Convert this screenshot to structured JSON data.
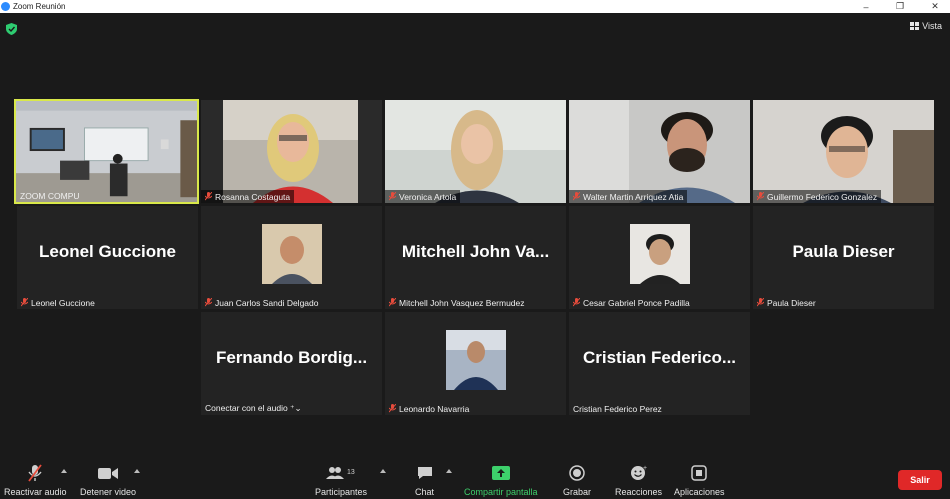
{
  "window": {
    "title": "Zoom Reunión",
    "minimize": "–",
    "maximize": "❐",
    "close": "✕"
  },
  "header": {
    "view_label": "Vista"
  },
  "tiles": [
    {
      "name": "ZOOM COMPU"
    },
    {
      "name": "Rosanna Costaguta"
    },
    {
      "name": "Veronica Artola"
    },
    {
      "name": "Walter Martin Arriquez Atia"
    },
    {
      "name": "Guillermo Federico Gonzalez"
    },
    {
      "big": "Leonel Guccione",
      "name": "Leonel Guccione"
    },
    {
      "name": "Juan Carlos Sandi Delgado"
    },
    {
      "big": "Mitchell John Va...",
      "name": "Mitchell John Vasquez Bermudez"
    },
    {
      "name": "Cesar Gabriel Ponce Padilla"
    },
    {
      "big": "Paula Dieser",
      "name": "Paula Dieser"
    },
    {
      "big": "Fernando Bordig...",
      "name": "Conectar con el audio ⁺⌄"
    },
    {
      "name": "Leonardo Navarria"
    },
    {
      "big": "Cristian Federico...",
      "name": "Cristian Federico Perez"
    }
  ],
  "toolbar": {
    "audio": "Reactivar audio",
    "video": "Detener video",
    "participants": "Participantes",
    "participants_count": "13",
    "chat": "Chat",
    "share": "Compartir pantalla",
    "record": "Grabar",
    "reactions": "Reacciones",
    "apps": "Aplicaciones",
    "leave": "Salir"
  },
  "colors": {
    "active_speaker_border": "#d9e84a",
    "share_green": "#3dd06b",
    "leave_red": "#e02828"
  }
}
